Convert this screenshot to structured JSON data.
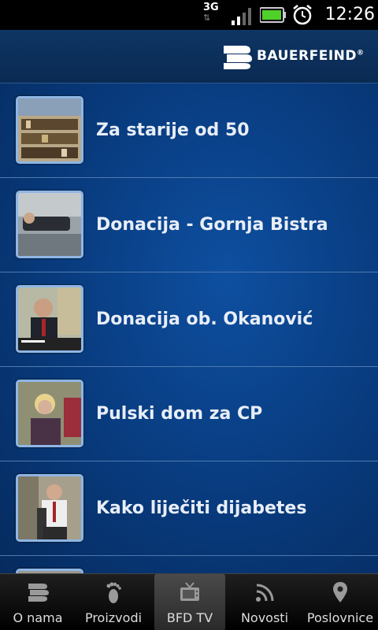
{
  "status_bar": {
    "network": "3G",
    "network_arrows": "⇅",
    "time": "12:26"
  },
  "header": {
    "brand": "BAUERFEIND",
    "registered": "®"
  },
  "videos": [
    {
      "title": "Za starije od 50"
    },
    {
      "title": "Donacija - Gornja Bistra"
    },
    {
      "title": "Donacija ob. Okanović"
    },
    {
      "title": "Pulski dom za CP"
    },
    {
      "title": "Kako liječiti dijabetes"
    }
  ],
  "tabs": [
    {
      "label": "O nama",
      "icon": "bauerfeind-icon",
      "active": false
    },
    {
      "label": "Proizvodi",
      "icon": "footprint-icon",
      "active": false
    },
    {
      "label": "BFD TV",
      "icon": "tv-icon",
      "active": true
    },
    {
      "label": "Novosti",
      "icon": "rss-icon",
      "active": false
    },
    {
      "label": "Poslovnice",
      "icon": "location-pin-icon",
      "active": false
    }
  ],
  "colors": {
    "header_bg": "#0e3564",
    "list_bg": "#083a7c",
    "thumb_border": "#8fb6e4",
    "item_text": "#e8eef7"
  }
}
